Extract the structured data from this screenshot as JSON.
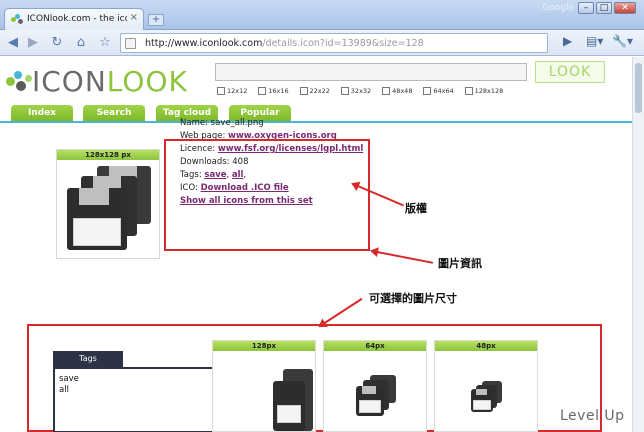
{
  "browser": {
    "tab_title": "ICONlook.com - the icon se...",
    "tab_close": "×",
    "new_tab": "+",
    "brand": "Google",
    "url_host": "http://www.iconlook.com",
    "url_path": "/details.icon?id=13989&size=128",
    "colors": {
      "chrome": "#c9daf2",
      "accent": "#45b8d6"
    }
  },
  "site": {
    "logo_left": "ICON",
    "logo_right": "LOOK",
    "search_button": "LOOK",
    "sizes": [
      "12x12",
      "16x16",
      "22x22",
      "32x32",
      "48x48",
      "64x64",
      "128x128"
    ],
    "nav": [
      "Index",
      "Search",
      "Tag cloud",
      "Popular"
    ]
  },
  "icon": {
    "preview_header": "128x128 px",
    "name_label": "Name:",
    "name": "save_all.png",
    "webpage_label": "Web page:",
    "webpage": "www.oxygen-icons.org",
    "licence_label": "Licence:",
    "licence": "www.fsf.org/licenses/lgpl.html",
    "downloads_label": "Downloads:",
    "downloads": "408",
    "tags_label": "Tags:",
    "tag1": "save",
    "tag_sep": ",",
    "tag2": "all",
    "tag_end": ",",
    "ico_label": "ICO:",
    "ico": "Download .ICO file",
    "show_all": "Show all icons from this set"
  },
  "annotations": {
    "copyright": "版權",
    "image_info": "圖片資訊",
    "sizes": "可選擇的圖片尺寸"
  },
  "tags_panel": {
    "title": "Tags",
    "items": [
      "save",
      "all"
    ]
  },
  "size_cards": [
    "128px",
    "64px",
    "48px"
  ],
  "watermark": "Level Up"
}
